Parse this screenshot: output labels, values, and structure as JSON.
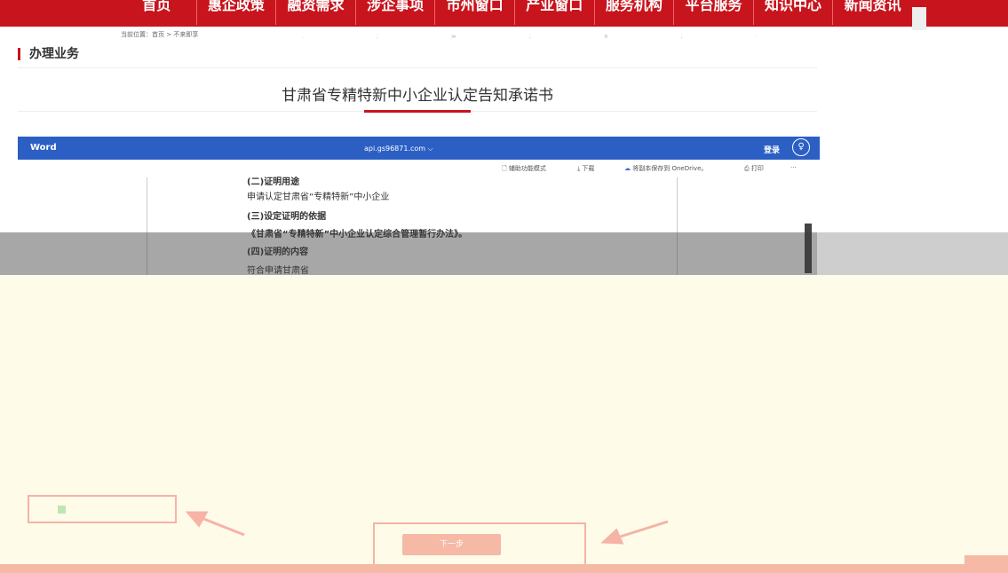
{
  "nav": {
    "items": [
      "首页",
      "惠企政策",
      "融资需求",
      "涉企事项",
      "市州窗口",
      "产业窗口",
      "服务机构",
      "平台服务",
      "知识中心",
      "新闻资讯"
    ]
  },
  "breadcrumb": "当前位置：首页 > 不来即享",
  "section_title": "办理业务",
  "doc_title": "甘肃省专精特新中小企业认定告知承诺书",
  "word": {
    "app": "Word",
    "host": "api.gs96871.com ⌵",
    "login": "登录",
    "toolbar": {
      "accessibility": "辅助功能模式",
      "download": "下载",
      "onedrive": "将副本保存到 OneDrive。",
      "print": "打印",
      "more": "···"
    }
  },
  "doc_lines": [
    "(二)证明用途",
    "申请认定甘肃省“专精特新”中小企业",
    "(三)设定证明的依据",
    "《甘肃省“专精特新”中小企业认定综合管理暂行办法》。",
    "(四)证明的内容",
    "符合申请甘肃省"
  ],
  "next_button": "下一步",
  "colors": {
    "brand_red": "#c8141c",
    "word_blue": "#2b5fc4",
    "overlay": "#fefbe9",
    "highlight": "#f6b3a6"
  }
}
